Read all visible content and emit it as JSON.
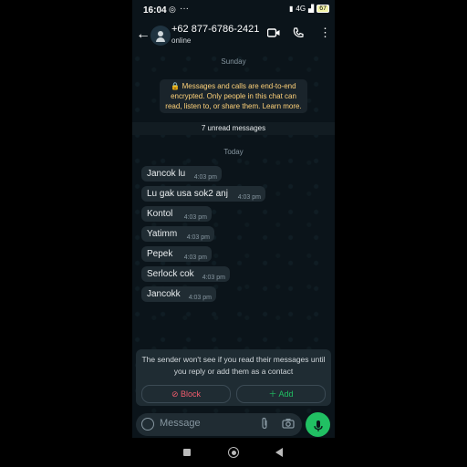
{
  "status_bar": {
    "time": "16:04",
    "whatsapp_icon": "whatsapp-notification-icon",
    "more": "···",
    "network": "4G",
    "battery": "67"
  },
  "header": {
    "contact_name": "+62 877-6786-2421",
    "contact_status": "online",
    "icons": [
      "back-arrow-icon",
      "video-call-icon",
      "voice-call-icon",
      "more-vert-icon"
    ]
  },
  "chat": {
    "date_sunday": "Sunday",
    "encryption_notice": "🔒 Messages and calls are end-to-end encrypted. Only people in this chat can read, listen to, or share them. Learn more.",
    "unread_banner": "7 unread messages",
    "date_today": "Today",
    "messages": [
      {
        "text": "Jancok lu",
        "time": "4:03 pm"
      },
      {
        "text": "Lu gak usa sok2 anj",
        "time": "4:03 pm"
      },
      {
        "text": "Kontol",
        "time": "4:03 pm"
      },
      {
        "text": "Yatimm",
        "time": "4:03 pm"
      },
      {
        "text": "Pepek",
        "time": "4:03 pm"
      },
      {
        "text": "Serlock cok",
        "time": "4:03 pm"
      },
      {
        "text": "Jancokk",
        "time": "4:03 pm"
      }
    ]
  },
  "unknown_sender": {
    "notice": "The sender won't see if you read their messages until you reply or add them as a contact",
    "block_label": "Block",
    "add_label": "Add",
    "colors": {
      "block": "#f15c6d",
      "add": "#21c063"
    }
  },
  "composer": {
    "placeholder": "Message",
    "icons": [
      "sticker-icon",
      "attach-icon",
      "camera-icon",
      "mic-icon"
    ]
  },
  "colors": {
    "accent": "#21c063",
    "bubble": "#202c33",
    "background": "#0b141a"
  }
}
